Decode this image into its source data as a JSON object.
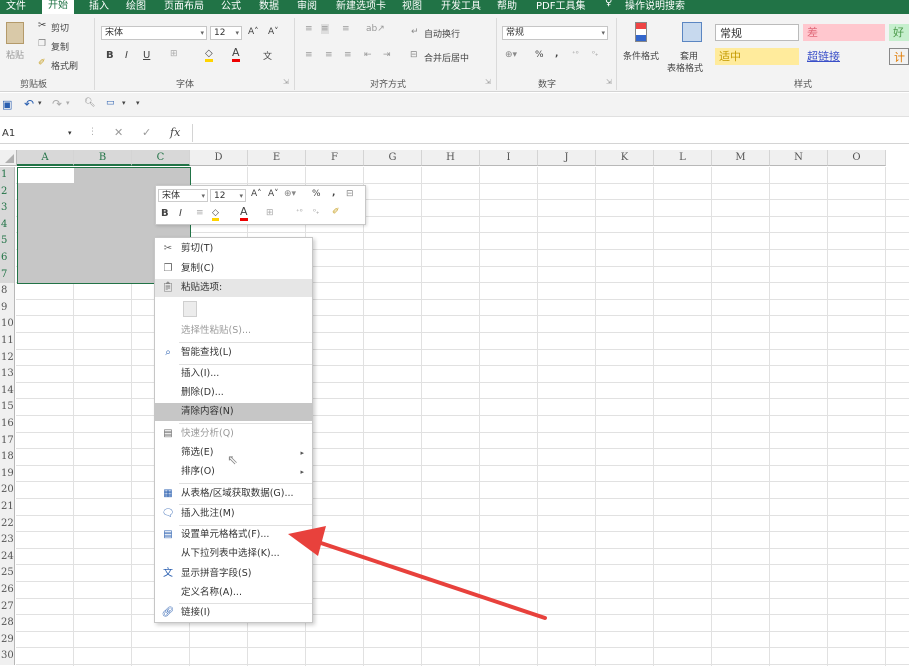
{
  "ribbon_tabs": [
    "文件",
    "开始",
    "插入",
    "绘图",
    "页面布局",
    "公式",
    "数据",
    "审阅",
    "新建选项卡",
    "视图",
    "开发工具",
    "帮助",
    "PDF工具集"
  ],
  "tell_me": "操作说明搜索",
  "clipboard": {
    "paste": "粘贴",
    "cut": "剪切",
    "copy": "复制",
    "format_painter": "格式刷",
    "group_label": "剪贴板"
  },
  "font": {
    "name": "宋体",
    "size": "12",
    "bold": "B",
    "italic": "I",
    "underline": "U",
    "font_color_glyph": "A",
    "group_label": "字体"
  },
  "alignment": {
    "wrap": "自动换行",
    "merge": "合并后居中",
    "group_label": "对齐方式"
  },
  "number": {
    "format": "常规",
    "percent": "%",
    "comma": ",",
    "group_label": "数字"
  },
  "styles": {
    "conditional": "条件格式",
    "table_format_1": "套用",
    "table_format_2": "表格格式",
    "normal": "常规",
    "bad": "差",
    "good": "好",
    "neutral": "适中",
    "hyperlink": "超链接",
    "calc": "计算",
    "group_label": "样式"
  },
  "formula_bar": {
    "name_box": "A1",
    "fx": "fx"
  },
  "columns": [
    "A",
    "B",
    "C",
    "D",
    "E",
    "F",
    "G",
    "H",
    "I",
    "J",
    "K",
    "L",
    "M",
    "N",
    "O"
  ],
  "rows": [
    "1",
    "2",
    "3",
    "4",
    "5",
    "6",
    "7",
    "8",
    "9",
    "10",
    "11",
    "12",
    "13",
    "14",
    "15",
    "16",
    "17",
    "18",
    "19",
    "20",
    "21",
    "22",
    "23",
    "24",
    "25",
    "26",
    "27",
    "28",
    "29",
    "30"
  ],
  "mini_toolbar": {
    "font": "宋体",
    "size": "12",
    "bold": "B",
    "italic": "I",
    "font_color": "A",
    "percent": "%"
  },
  "context_menu": {
    "items": [
      {
        "label": "剪切(T)",
        "icon": "scissors-icon"
      },
      {
        "label": "复制(C)",
        "icon": "copy-icon"
      },
      {
        "label": "粘贴选项:",
        "icon": "clipboard-icon"
      },
      {
        "label": "选择性粘贴(S)..."
      },
      {
        "label": "智能查找(L)",
        "icon": "search-icon"
      },
      {
        "label": "插入(I)..."
      },
      {
        "label": "删除(D)..."
      },
      {
        "label": "清除内容(N)"
      },
      {
        "label": "快速分析(Q)",
        "icon": "quick-analysis-icon"
      },
      {
        "label": "筛选(E)"
      },
      {
        "label": "排序(O)"
      },
      {
        "label": "从表格/区域获取数据(G)...",
        "icon": "table-icon"
      },
      {
        "label": "插入批注(M)",
        "icon": "comment-icon"
      },
      {
        "label": "设置单元格格式(F)...",
        "icon": "format-cells-icon"
      },
      {
        "label": "从下拉列表中选择(K)..."
      },
      {
        "label": "显示拼音字段(S)",
        "icon": "phonetic-icon"
      },
      {
        "label": "定义名称(A)..."
      },
      {
        "label": "链接(I)",
        "icon": "link-icon"
      }
    ]
  },
  "colors": {
    "excel_green": "#217346",
    "annotation_arrow": "#e8413c",
    "selection": "#c6c6c6"
  }
}
